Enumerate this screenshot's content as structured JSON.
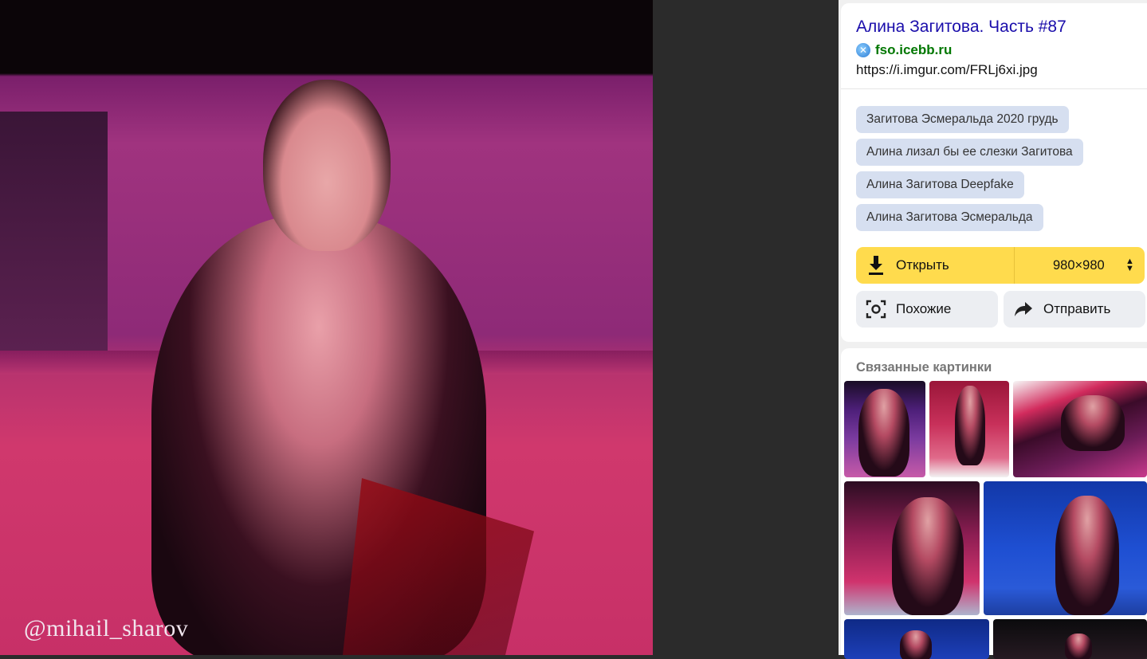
{
  "viewer": {
    "watermark": "@mihail_sharov"
  },
  "source": {
    "title": "Алина Загитова. Часть #87",
    "site": "fso.icebb.ru",
    "url": "https://i.imgur.com/FRLj6xi.jpg"
  },
  "tags": [
    "Загитова Эсмеральда 2020 грудь",
    "Алина лизал бы ее слезки Загитова",
    "Алина Загитова Deepfake",
    "Алина Загитова Эсмеральда"
  ],
  "actions": {
    "open_label": "Открыть",
    "size_label": "980×980",
    "similar_label": "Похожие",
    "send_label": "Отправить"
  },
  "related": {
    "title": "Связанные картинки"
  },
  "colors": {
    "accent_yellow": "#ffdb4d",
    "link_blue": "#1a0dab",
    "site_green": "#007700",
    "tag_bg": "#d6dff0"
  }
}
